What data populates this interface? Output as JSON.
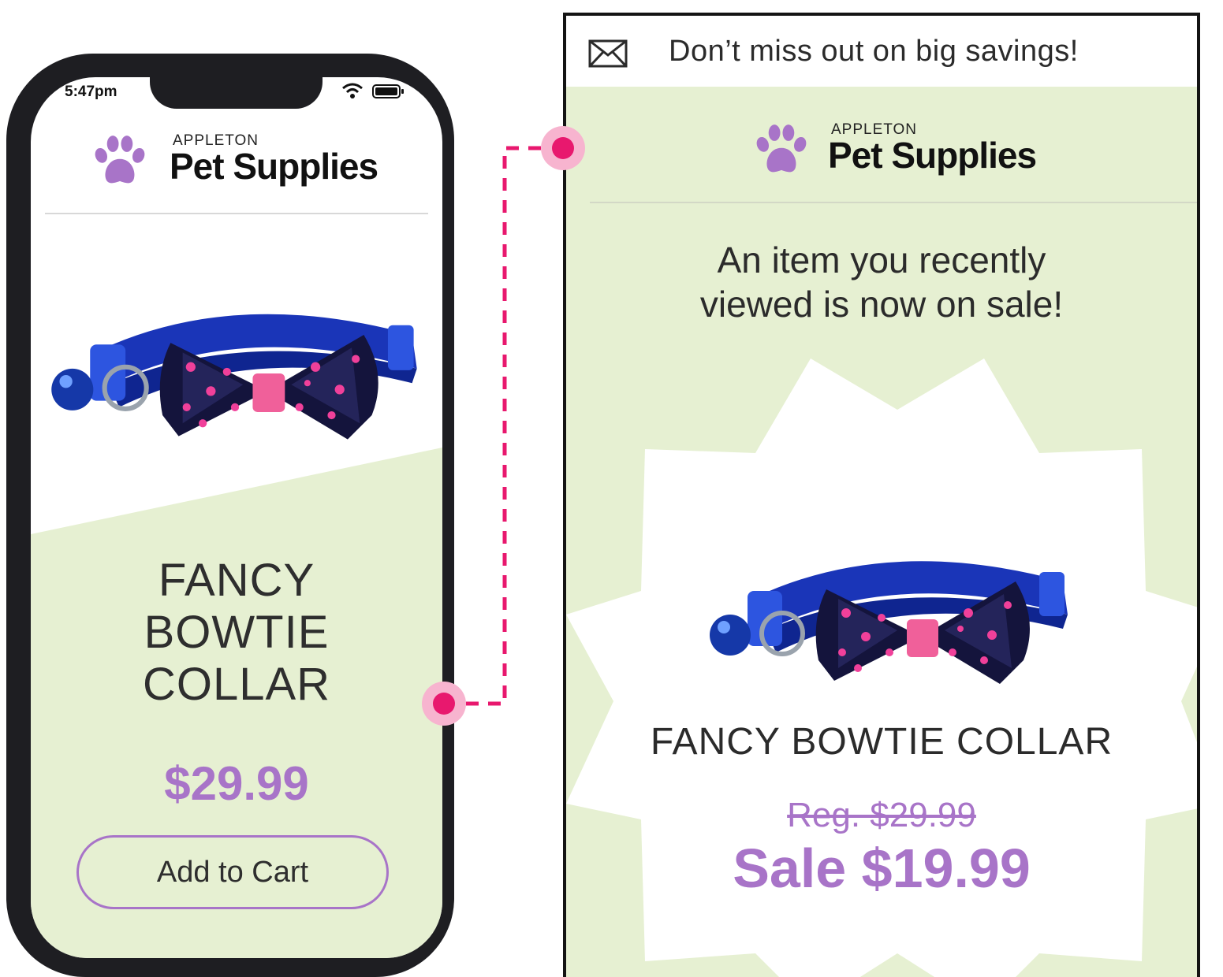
{
  "phone": {
    "status_time": "5:47pm",
    "logo": {
      "top": "APPLETON",
      "main": "Pet Supplies"
    },
    "product_name": "FANCY\nBOWTIE\nCOLLAR",
    "price": "$29.99",
    "add_to_cart_label": "Add to Cart"
  },
  "email": {
    "subject": "Don’t miss out on big savings!",
    "logo": {
      "top": "APPLETON",
      "main": "Pet Supplies"
    },
    "headline": "An item you recently\nviewed is now on sale!",
    "product_name": "FANCY BOWTIE COLLAR",
    "regular_price": "Reg. $29.99",
    "sale_price": "Sale $19.99"
  },
  "colors": {
    "accent_purple": "#a874c8",
    "connector_pink": "#e8186e",
    "green_bg": "#e6f0d2",
    "collar_blue": "#1a35b8"
  },
  "icons": [
    "paw-icon",
    "wifi-icon",
    "battery-icon",
    "mail-icon"
  ]
}
